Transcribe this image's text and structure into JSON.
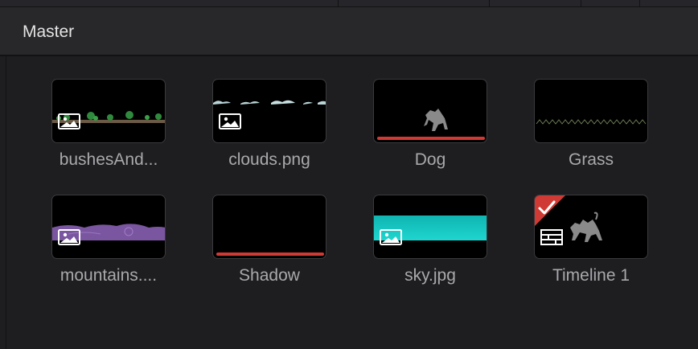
{
  "panel": {
    "title": "Master"
  },
  "clips": [
    {
      "name": "bushesAnd...",
      "type": "image"
    },
    {
      "name": "clouds.png",
      "type": "image"
    },
    {
      "name": "Dog",
      "type": "video"
    },
    {
      "name": "Grass",
      "type": "video"
    },
    {
      "name": "mountains....",
      "type": "image"
    },
    {
      "name": "Shadow",
      "type": "video"
    },
    {
      "name": "sky.jpg",
      "type": "image"
    },
    {
      "name": "Timeline 1",
      "type": "timeline",
      "selected": true
    }
  ],
  "colors": {
    "accent_red": "#d03a35",
    "sky": "#19c9c4",
    "mountain": "#7a55a0"
  }
}
